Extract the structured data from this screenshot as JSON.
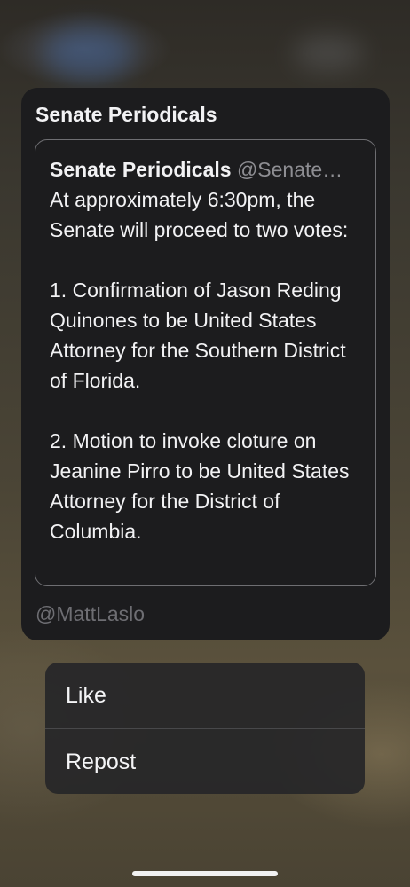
{
  "preview": {
    "title": "Senate Periodicals",
    "tweet": {
      "author_name": "Senate Periodicals",
      "author_handle": "@Senate…",
      "text": "At approximately 6:30pm, the Senate will proceed to two votes:\n\n1. Confirmation of Jason Reding Quinones to be United States Attorney for the Southern District of Florida.\n\n2. Motion to invoke cloture on Jeanine Pirro to be United States Attorney for the District of Columbia."
    },
    "footer": "@MattLaslo"
  },
  "menu": {
    "items": [
      {
        "label": "Like"
      },
      {
        "label": "Repost"
      }
    ]
  },
  "colors": {
    "card_background": "#1c1c1e",
    "text_primary": "#f2f2f4",
    "text_secondary": "#8e8e93",
    "menu_background": "#262628"
  }
}
